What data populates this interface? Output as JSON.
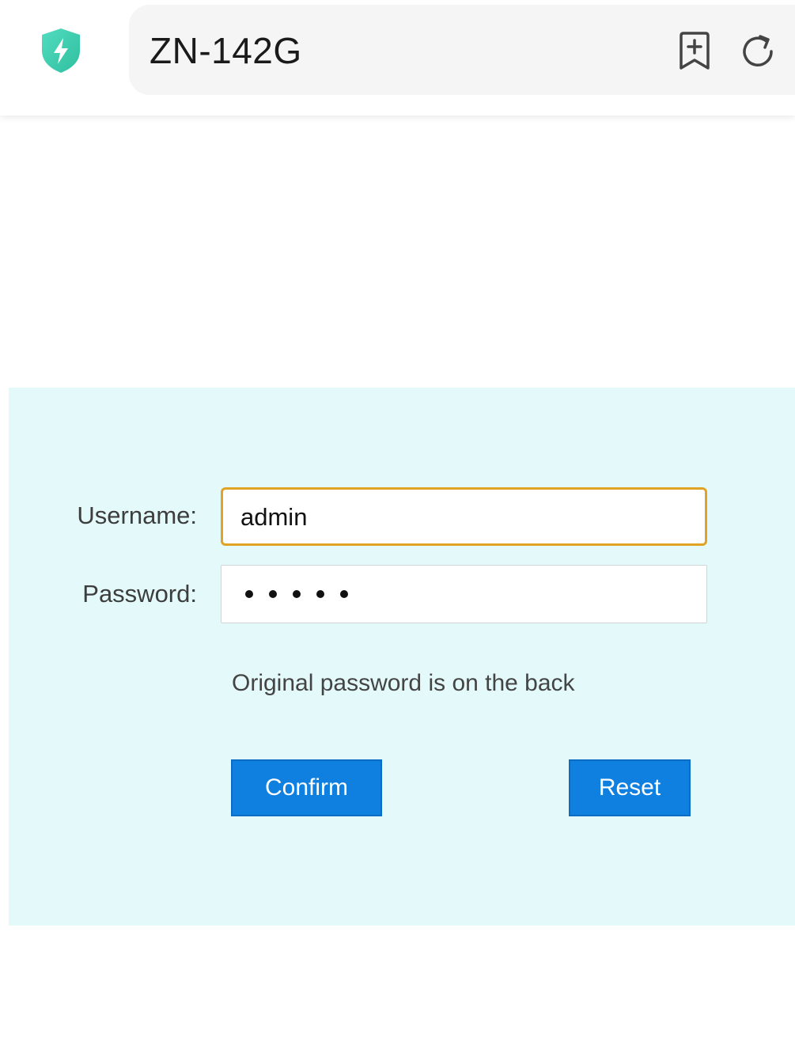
{
  "browser": {
    "address": "ZN-142G",
    "icons": {
      "security": "shield-lightning-icon",
      "bookmark": "bookmark-add-icon",
      "reload": "reload-icon"
    },
    "colors": {
      "shield": "#3ecfb0",
      "address_bar": "#f5f5f5"
    }
  },
  "login": {
    "username_label": "Username:",
    "username_value": "admin",
    "password_label": "Password:",
    "password_masked": "•••••",
    "hint": "Original password is on the back",
    "confirm_label": "Confirm",
    "reset_label": "Reset",
    "colors": {
      "panel_bg": "#e4fafa",
      "button_bg": "#0f7fe0",
      "focus_border": "#e0a325"
    }
  }
}
